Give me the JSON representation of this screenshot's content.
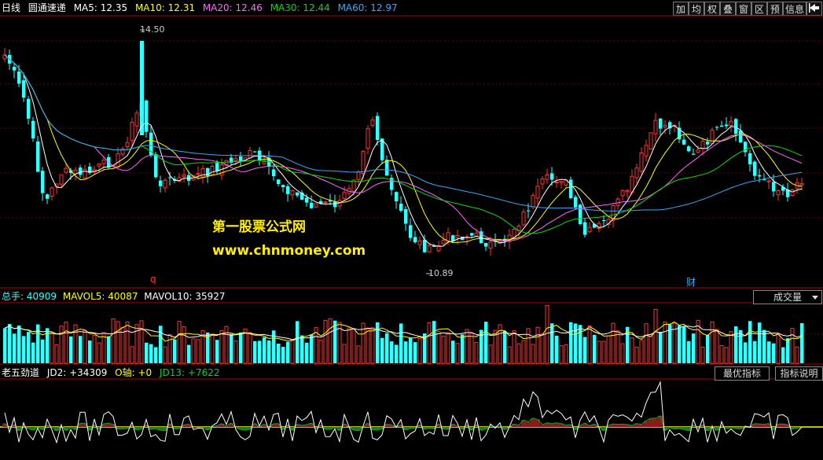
{
  "header": {
    "period": "日线",
    "name": "圆通速递",
    "ma": [
      {
        "label": "MA5: 12.35",
        "color": "#ffffff"
      },
      {
        "label": "MA10: 12.31",
        "color": "#ffff00"
      },
      {
        "label": "MA20: 12.46",
        "color": "#ff66ff"
      },
      {
        "label": "MA30: 12.44",
        "color": "#00dd00"
      },
      {
        "label": "MA60: 12.97",
        "color": "#33aaff"
      }
    ]
  },
  "toolbar": {
    "add": "加",
    "avg": "均",
    "right": "权",
    "overlay": "叠",
    "window": "窗",
    "zone": "区",
    "forecast": "预",
    "info": "信息"
  },
  "price": {
    "high_label": "14.50",
    "low_label": "10.89",
    "marker_q": "q",
    "marker_cai": "财"
  },
  "watermark": {
    "line1": "第一股票公式网",
    "line2": "www.chnmoney.com"
  },
  "volume": {
    "title": "总手: 40909",
    "mavol5": "MAVOL5: 40087",
    "mavol10": "MAVOL10: 35927",
    "dropdown": "成交量",
    "colors": {
      "title": "#33ffff",
      "mavol5": "#ffff00",
      "mavol10": "#ffffff"
    }
  },
  "indicator": {
    "name": "老五劲道",
    "jd2": "JD2: +34309",
    "oaxis": "O轴: +0",
    "jd13": "JD13: +7622",
    "best": "最优指标",
    "help": "指标说明"
  },
  "colors": {
    "up": "#ff3333",
    "down": "#33ffff",
    "grid": "#880000",
    "accent": "#ffee00"
  }
}
